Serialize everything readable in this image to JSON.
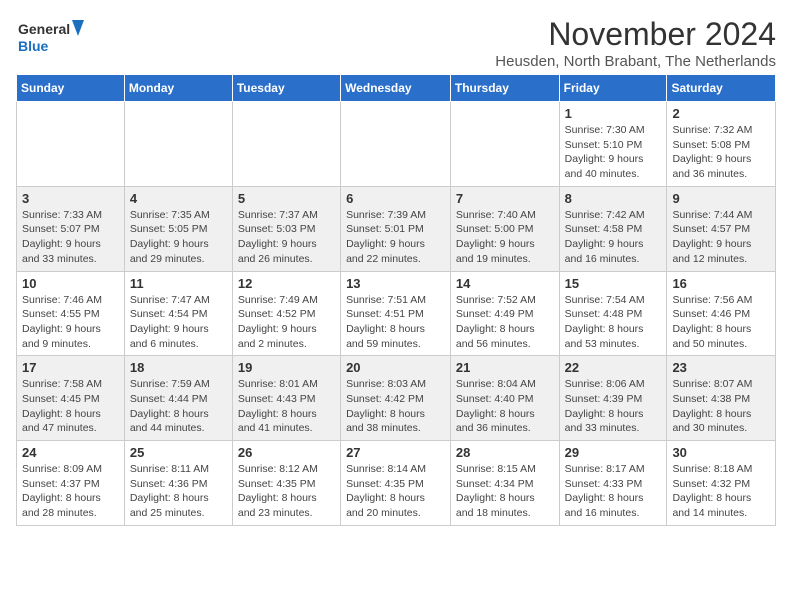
{
  "logo": {
    "text_general": "General",
    "text_blue": "Blue"
  },
  "title": "November 2024",
  "subtitle": "Heusden, North Brabant, The Netherlands",
  "headers": [
    "Sunday",
    "Monday",
    "Tuesday",
    "Wednesday",
    "Thursday",
    "Friday",
    "Saturday"
  ],
  "weeks": [
    [
      {
        "day": "",
        "info": ""
      },
      {
        "day": "",
        "info": ""
      },
      {
        "day": "",
        "info": ""
      },
      {
        "day": "",
        "info": ""
      },
      {
        "day": "",
        "info": ""
      },
      {
        "day": "1",
        "info": "Sunrise: 7:30 AM\nSunset: 5:10 PM\nDaylight: 9 hours and 40 minutes."
      },
      {
        "day": "2",
        "info": "Sunrise: 7:32 AM\nSunset: 5:08 PM\nDaylight: 9 hours and 36 minutes."
      }
    ],
    [
      {
        "day": "3",
        "info": "Sunrise: 7:33 AM\nSunset: 5:07 PM\nDaylight: 9 hours and 33 minutes."
      },
      {
        "day": "4",
        "info": "Sunrise: 7:35 AM\nSunset: 5:05 PM\nDaylight: 9 hours and 29 minutes."
      },
      {
        "day": "5",
        "info": "Sunrise: 7:37 AM\nSunset: 5:03 PM\nDaylight: 9 hours and 26 minutes."
      },
      {
        "day": "6",
        "info": "Sunrise: 7:39 AM\nSunset: 5:01 PM\nDaylight: 9 hours and 22 minutes."
      },
      {
        "day": "7",
        "info": "Sunrise: 7:40 AM\nSunset: 5:00 PM\nDaylight: 9 hours and 19 minutes."
      },
      {
        "day": "8",
        "info": "Sunrise: 7:42 AM\nSunset: 4:58 PM\nDaylight: 9 hours and 16 minutes."
      },
      {
        "day": "9",
        "info": "Sunrise: 7:44 AM\nSunset: 4:57 PM\nDaylight: 9 hours and 12 minutes."
      }
    ],
    [
      {
        "day": "10",
        "info": "Sunrise: 7:46 AM\nSunset: 4:55 PM\nDaylight: 9 hours and 9 minutes."
      },
      {
        "day": "11",
        "info": "Sunrise: 7:47 AM\nSunset: 4:54 PM\nDaylight: 9 hours and 6 minutes."
      },
      {
        "day": "12",
        "info": "Sunrise: 7:49 AM\nSunset: 4:52 PM\nDaylight: 9 hours and 2 minutes."
      },
      {
        "day": "13",
        "info": "Sunrise: 7:51 AM\nSunset: 4:51 PM\nDaylight: 8 hours and 59 minutes."
      },
      {
        "day": "14",
        "info": "Sunrise: 7:52 AM\nSunset: 4:49 PM\nDaylight: 8 hours and 56 minutes."
      },
      {
        "day": "15",
        "info": "Sunrise: 7:54 AM\nSunset: 4:48 PM\nDaylight: 8 hours and 53 minutes."
      },
      {
        "day": "16",
        "info": "Sunrise: 7:56 AM\nSunset: 4:46 PM\nDaylight: 8 hours and 50 minutes."
      }
    ],
    [
      {
        "day": "17",
        "info": "Sunrise: 7:58 AM\nSunset: 4:45 PM\nDaylight: 8 hours and 47 minutes."
      },
      {
        "day": "18",
        "info": "Sunrise: 7:59 AM\nSunset: 4:44 PM\nDaylight: 8 hours and 44 minutes."
      },
      {
        "day": "19",
        "info": "Sunrise: 8:01 AM\nSunset: 4:43 PM\nDaylight: 8 hours and 41 minutes."
      },
      {
        "day": "20",
        "info": "Sunrise: 8:03 AM\nSunset: 4:42 PM\nDaylight: 8 hours and 38 minutes."
      },
      {
        "day": "21",
        "info": "Sunrise: 8:04 AM\nSunset: 4:40 PM\nDaylight: 8 hours and 36 minutes."
      },
      {
        "day": "22",
        "info": "Sunrise: 8:06 AM\nSunset: 4:39 PM\nDaylight: 8 hours and 33 minutes."
      },
      {
        "day": "23",
        "info": "Sunrise: 8:07 AM\nSunset: 4:38 PM\nDaylight: 8 hours and 30 minutes."
      }
    ],
    [
      {
        "day": "24",
        "info": "Sunrise: 8:09 AM\nSunset: 4:37 PM\nDaylight: 8 hours and 28 minutes."
      },
      {
        "day": "25",
        "info": "Sunrise: 8:11 AM\nSunset: 4:36 PM\nDaylight: 8 hours and 25 minutes."
      },
      {
        "day": "26",
        "info": "Sunrise: 8:12 AM\nSunset: 4:35 PM\nDaylight: 8 hours and 23 minutes."
      },
      {
        "day": "27",
        "info": "Sunrise: 8:14 AM\nSunset: 4:35 PM\nDaylight: 8 hours and 20 minutes."
      },
      {
        "day": "28",
        "info": "Sunrise: 8:15 AM\nSunset: 4:34 PM\nDaylight: 8 hours and 18 minutes."
      },
      {
        "day": "29",
        "info": "Sunrise: 8:17 AM\nSunset: 4:33 PM\nDaylight: 8 hours and 16 minutes."
      },
      {
        "day": "30",
        "info": "Sunrise: 8:18 AM\nSunset: 4:32 PM\nDaylight: 8 hours and 14 minutes."
      }
    ]
  ]
}
